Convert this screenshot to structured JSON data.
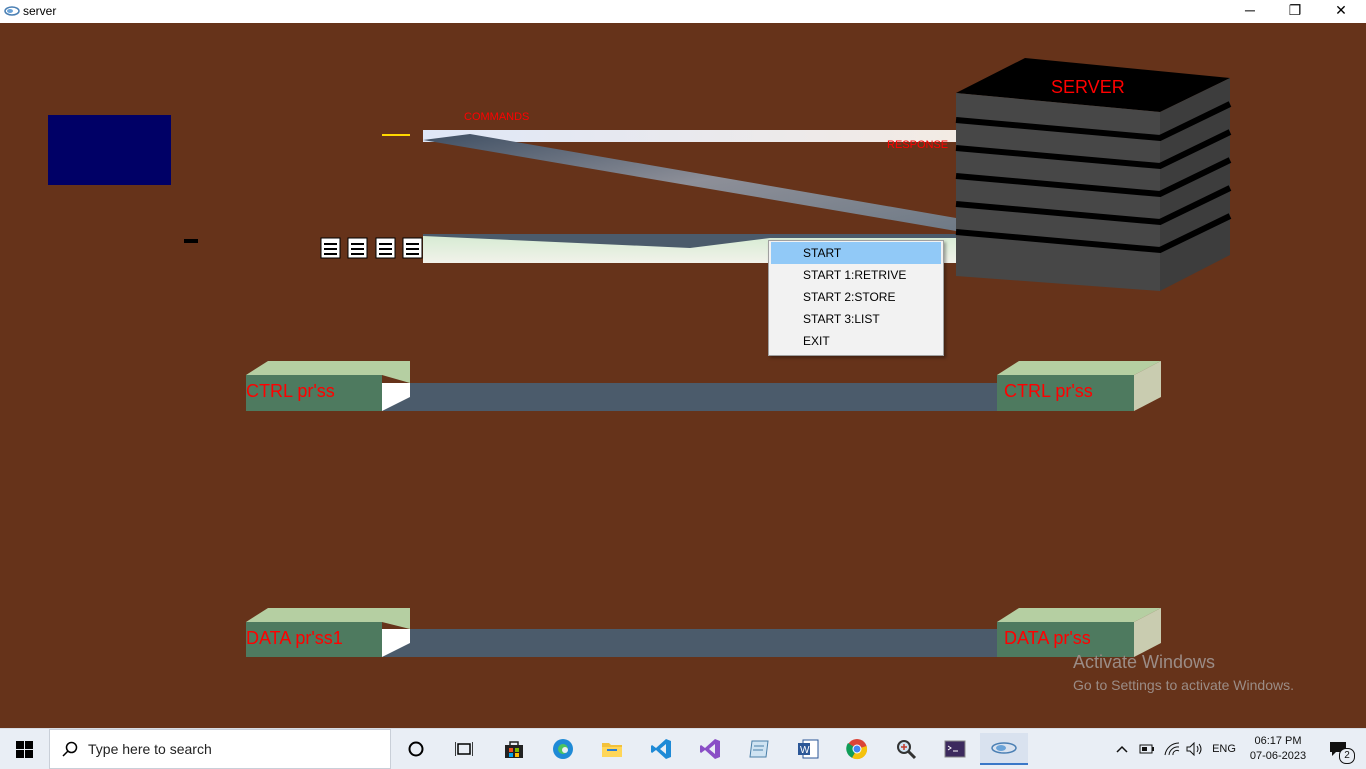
{
  "window": {
    "title": "server",
    "minimize": "─",
    "restore": "❐",
    "close": "✕"
  },
  "scene": {
    "commands_label": "COMMANDS",
    "response_label": "RESPONSE",
    "server_label": "SERVER",
    "ctrl_left": "CTRL pr'ss",
    "ctrl_right": "CTRL pr'ss",
    "data_left": "DATA pr'ss1",
    "data_right": "DATA pr'ss"
  },
  "context_menu": {
    "items": [
      {
        "label": "START",
        "highlighted": true
      },
      {
        "label": "START 1:RETRIVE"
      },
      {
        "label": "START 2:STORE"
      },
      {
        "label": "START 3:LIST"
      },
      {
        "label": "EXIT"
      }
    ]
  },
  "watermark": {
    "line1": "Activate Windows",
    "line2": "Go to Settings to activate Windows."
  },
  "taskbar": {
    "search_placeholder": "Type here to search",
    "language": "ENG",
    "time": "06:17 PM",
    "date": "07-06-2023",
    "notifications_count": "2"
  },
  "colors": {
    "background": "#66331a",
    "navy_box": "#000066",
    "label_red": "#ff0000",
    "process_face": "#4e7a5f",
    "process_top": "#b5cfa2",
    "pipe": "#4b5b6b",
    "menu_highlight": "#91c9f7"
  }
}
